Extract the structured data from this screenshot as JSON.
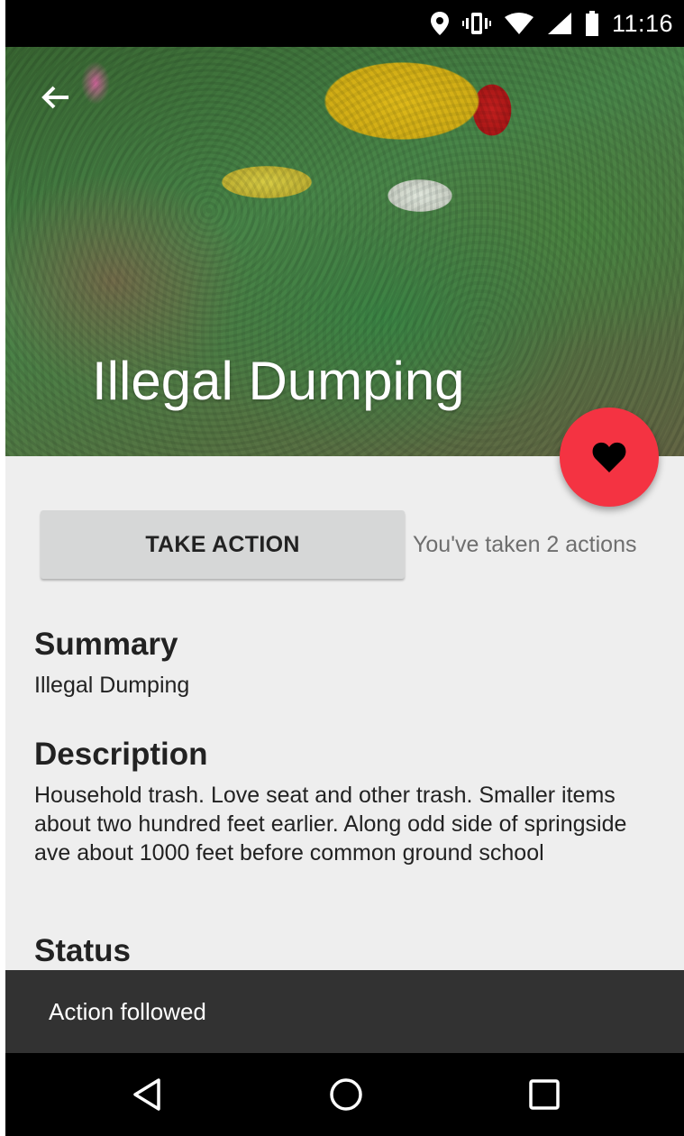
{
  "status_bar": {
    "time": "11:16",
    "icons": [
      "location-icon",
      "vibrate-icon",
      "wifi-icon",
      "signal-icon",
      "battery-icon"
    ]
  },
  "header": {
    "title": "Illegal Dumping",
    "back_icon": "arrow-back-icon"
  },
  "fab": {
    "icon": "heart-icon",
    "color": "#f43342"
  },
  "actions": {
    "button_label": "TAKE ACTION",
    "count_text": "You've taken 2 actions"
  },
  "sections": {
    "summary_heading": "Summary",
    "summary_text": "Illegal Dumping",
    "description_heading": "Description",
    "description_text": "Household trash. Love seat and other trash. Smaller items about two hundred feet earlier. Along odd side of springside ave about 1000 feet before common ground school",
    "status_heading": "Status"
  },
  "snackbar": {
    "text": "Action followed"
  },
  "nav_bar": {
    "icons": [
      "back-triangle-icon",
      "home-circle-icon",
      "recents-square-icon"
    ]
  },
  "colors": {
    "accent": "#f43342",
    "background": "#eeeeee",
    "button": "#d6d7d7",
    "snackbar": "#323232"
  }
}
